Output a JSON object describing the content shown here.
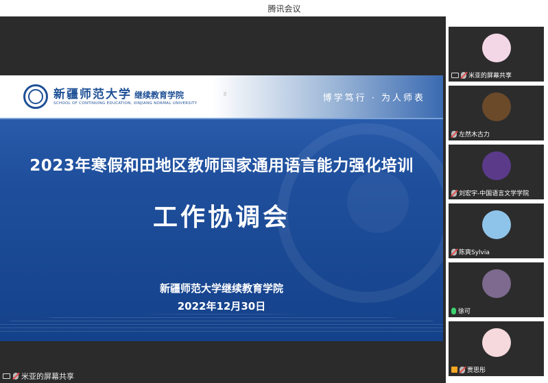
{
  "window": {
    "title": "腾讯会议"
  },
  "slide": {
    "university_cn": "新疆师范大学",
    "department_cn": "继续教育学院",
    "university_en": "SCHOOL OF CONTINUING EDUCATION, XINJIANG NORMAL UNIVERSITY",
    "motto": "博学笃行 · 为人师表",
    "main_title": "2023年寒假和田地区教师国家通用语言能力强化培训",
    "subtitle": "工作协调会",
    "organizer": "新疆师范大学继续教育学院",
    "date": "2022年12月30日"
  },
  "stage": {
    "share_label": "米亚的屏幕共享"
  },
  "participants": [
    {
      "name": "米亚的屏幕共享",
      "icon": "screen-share-icon",
      "mic": "muted",
      "avatar_color": "#f4d7e6"
    },
    {
      "name": "左然木古力",
      "icon": "",
      "mic": "muted",
      "avatar_color": "#6b4a2a"
    },
    {
      "name": "刘宏宇-中国语言文学学院",
      "icon": "",
      "mic": "muted",
      "avatar_color": "#5b3a8a"
    },
    {
      "name": "陈爽Sylvia",
      "icon": "",
      "mic": "muted",
      "avatar_color": "#8fc4ea"
    },
    {
      "name": "徐可",
      "icon": "",
      "mic": "on",
      "avatar_color": "#7d6a8e"
    },
    {
      "name": "贾思彤",
      "icon": "user-icon",
      "mic": "muted",
      "avatar_color": "#f6d9dc"
    }
  ],
  "colors": {
    "slide_blue": "#1f4f9c",
    "mic_muted": "#e94b4b",
    "mic_on": "#3bd16f"
  }
}
